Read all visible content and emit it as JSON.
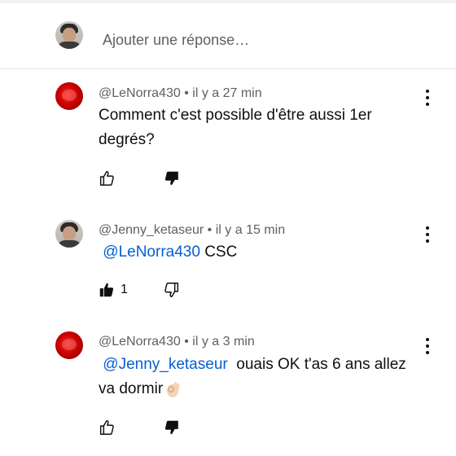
{
  "reply_box": {
    "placeholder": "Ajouter une réponse…"
  },
  "comments": [
    {
      "author": "@LeNorra430",
      "separator": "•",
      "time": "il y a 27 min",
      "text": "Comment c'est possible d'être aussi 1er degrés?",
      "likes": ""
    },
    {
      "author": "@Jenny_ketaseur",
      "separator": "•",
      "time": "il y a 15 min",
      "mention": "@LeNorra430",
      "text": "CSC",
      "likes": "1",
      "liked": true
    },
    {
      "author": "@LeNorra430",
      "separator": "•",
      "time": "il y a 3 min",
      "mention": "@Jenny_ketaseur",
      "text_line1": "ouais OK t'as 6 ans allez",
      "text_line2": "va dormir",
      "emoji": "ok-hand-emoji",
      "likes": ""
    }
  ],
  "icons": {
    "like": "thumb-up-icon",
    "dislike": "thumb-down-icon",
    "menu": "more-vertical-icon"
  },
  "colors": {
    "mention": "#065fd4",
    "meta": "#606060",
    "text": "#0f0f0f"
  }
}
